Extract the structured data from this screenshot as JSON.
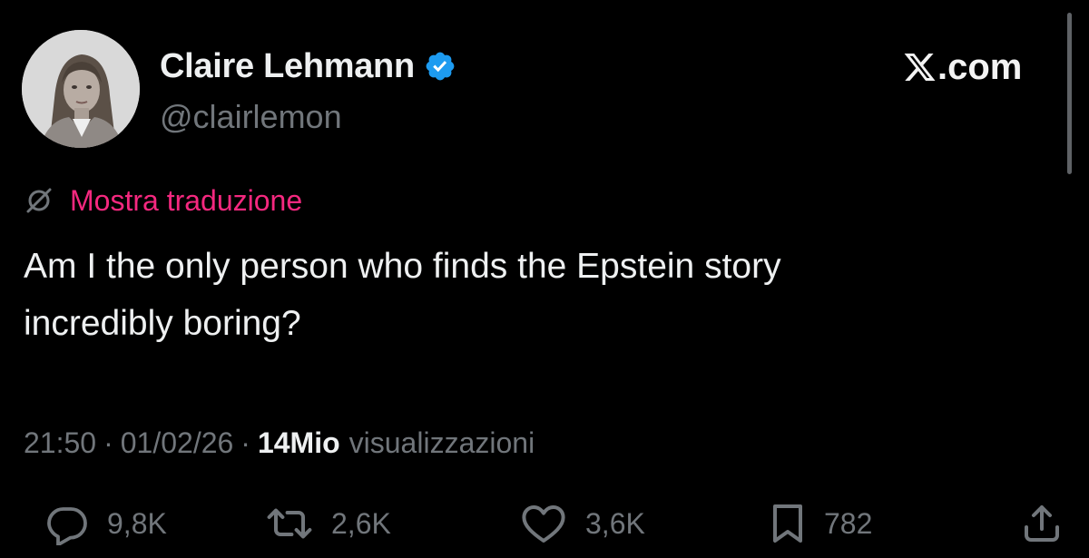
{
  "author": {
    "display_name": "Claire Lehmann",
    "handle": "@clairlemon",
    "verified": true,
    "verified_color": "#1d9bf0"
  },
  "site": {
    "logo": "x-logo-icon",
    "label": ".com"
  },
  "translation": {
    "icon": "globe-off-icon",
    "link_label": "Mostra traduzione",
    "link_color": "#f5287f"
  },
  "tweet": {
    "text_line1": "Am I the only person who finds the Epstein story",
    "text_line2": "incredibly boring?"
  },
  "meta": {
    "time": "21:50",
    "separator": "·",
    "date": "01/02/26",
    "views_count": "14Mio",
    "views_label": "visualizzazioni"
  },
  "actions": {
    "reply": {
      "icon": "reply-icon",
      "count": "9,8K"
    },
    "repost": {
      "icon": "repost-icon",
      "count": "2,6K"
    },
    "like": {
      "icon": "heart-icon",
      "count": "3,6K"
    },
    "bookmark": {
      "icon": "bookmark-icon",
      "count": "782"
    },
    "share": {
      "icon": "share-icon"
    }
  },
  "colors": {
    "background": "#000000",
    "text_primary": "#eef0f1",
    "text_secondary": "#71767b"
  }
}
